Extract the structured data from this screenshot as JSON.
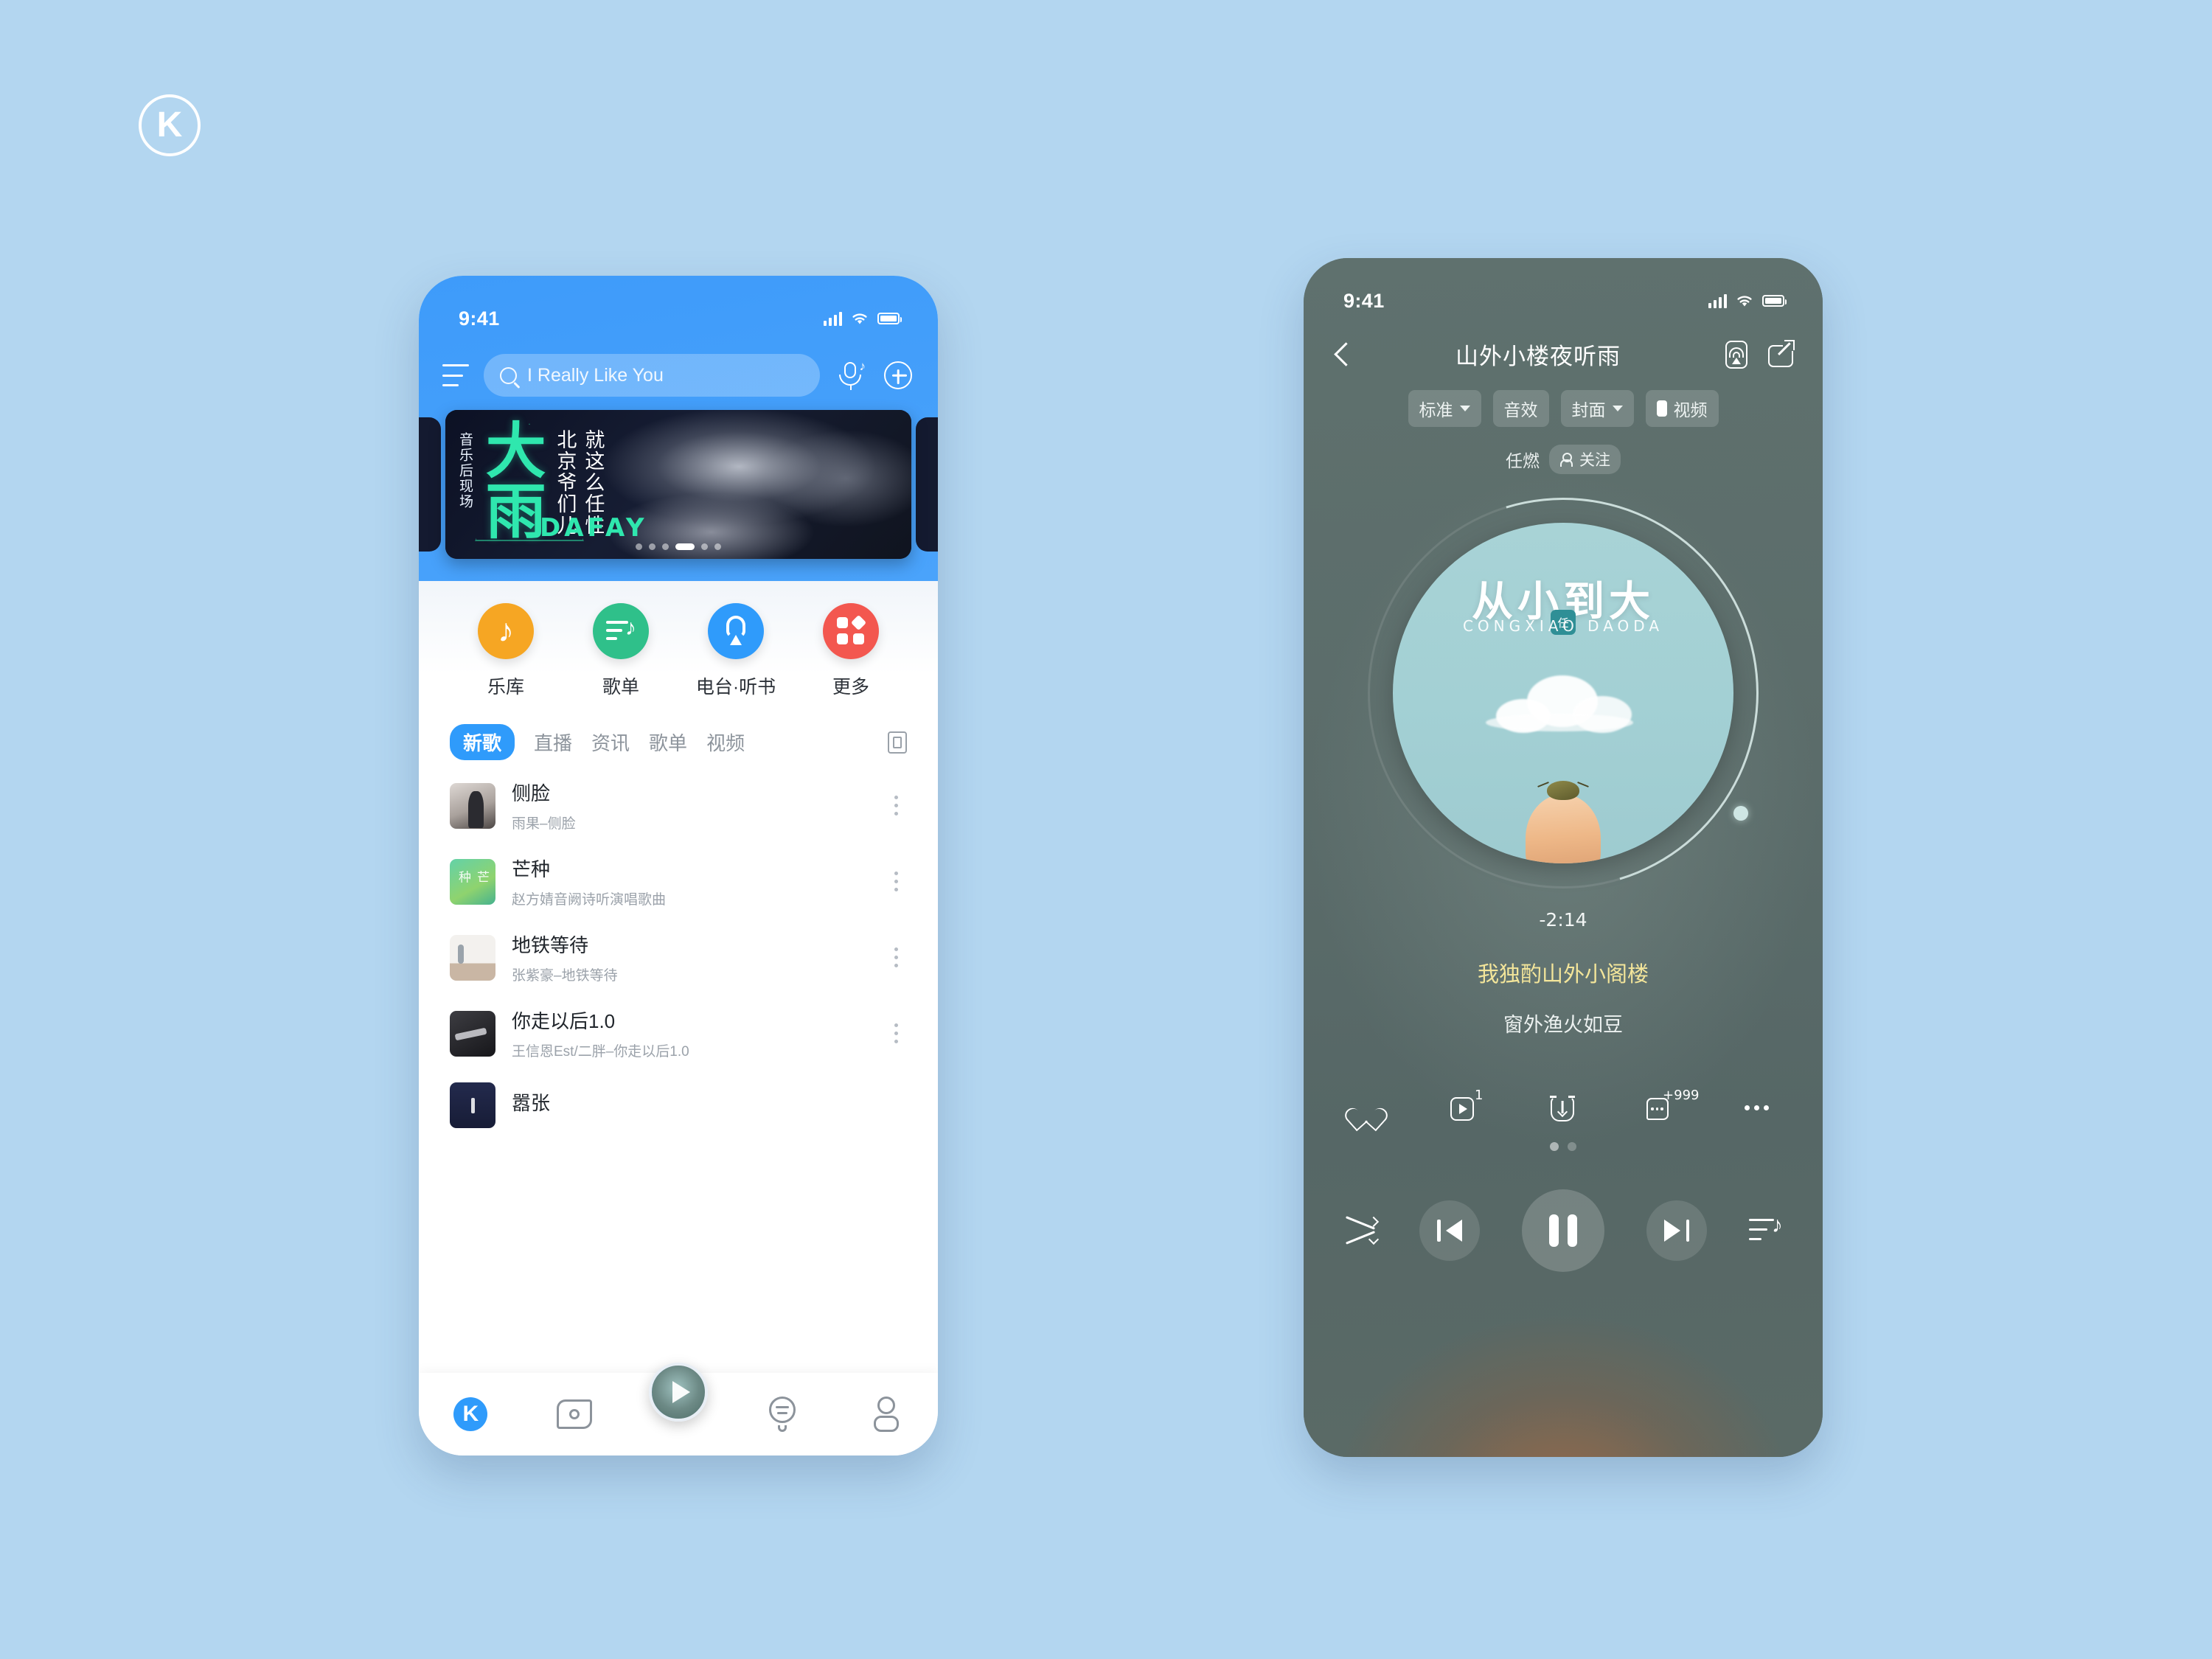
{
  "brand": {
    "logo_letter": "K"
  },
  "home": {
    "status": {
      "time": "9:41"
    },
    "search": {
      "placeholder": "I Really Like You",
      "value": ""
    },
    "header_icons": {
      "menu": "hamburger-menu-icon",
      "voice": "voice-search-icon",
      "add": "plus-circle-icon"
    },
    "banner": {
      "vertical_left": "音乐后现场",
      "big_word": "大雨",
      "col1": "北京爷们儿",
      "col2": "就这么任性",
      "latin": "DAFAY",
      "dots_total": 6,
      "dots_active": 3
    },
    "categories": [
      {
        "label": "乐库",
        "color": "#f6a623",
        "icon": "music-note-icon"
      },
      {
        "label": "歌单",
        "color": "#2fc08a",
        "icon": "playlist-icon"
      },
      {
        "label": "电台·听书",
        "color": "#2f9bfb",
        "icon": "radio-icon"
      },
      {
        "label": "更多",
        "color": "#f3574f",
        "icon": "grid-more-icon"
      }
    ],
    "tabs": [
      {
        "label": "新歌",
        "active": true
      },
      {
        "label": "直播",
        "active": false
      },
      {
        "label": "资讯",
        "active": false
      },
      {
        "label": "歌单",
        "active": false
      },
      {
        "label": "视频",
        "active": false
      }
    ],
    "tabs_right_icon": "multi-window-icon",
    "songs": [
      {
        "title": "侧脸",
        "subtitle": "雨果–侧脸"
      },
      {
        "title": "芒种",
        "subtitle": "赵方婧音阙诗听演唱歌曲"
      },
      {
        "title": "地铁等待",
        "subtitle": "张紫豪–地铁等待"
      },
      {
        "title": "你走以后1.0",
        "subtitle": "王信恩Est/二胖–你走以后1.0"
      },
      {
        "title": "嚣张",
        "subtitle": ""
      }
    ],
    "bottom_nav": [
      {
        "name": "home",
        "label": "K",
        "icon": "k-logo-icon",
        "active": true
      },
      {
        "name": "video",
        "label": "",
        "icon": "camera-icon",
        "active": false
      },
      {
        "name": "player",
        "label": "",
        "icon": "mini-player-play-icon",
        "active": false
      },
      {
        "name": "discover",
        "label": "",
        "icon": "discover-icon",
        "active": false
      },
      {
        "name": "profile",
        "label": "",
        "icon": "user-icon",
        "active": false
      }
    ]
  },
  "player": {
    "status": {
      "time": "9:41"
    },
    "title": "山外小楼夜听雨",
    "back_icon": "chevron-left-icon",
    "cast_icon": "cast-icon",
    "share_icon": "share-external-icon",
    "chips": [
      {
        "label": "标准",
        "caret": true
      },
      {
        "label": "音效",
        "caret": false
      },
      {
        "label": "封面",
        "caret": true
      },
      {
        "label": "视频",
        "caret": false,
        "glyph": "phone-icon"
      }
    ],
    "artist": {
      "name": "任燃",
      "follow_label": "关注",
      "follow_icon": "user-add-icon"
    },
    "album_art": {
      "title": "从小到大",
      "seal": "任",
      "pinyin": "CONGXIAO DAODA"
    },
    "time_remaining": "-2:14",
    "lyrics": {
      "current": "我独酌山外小阁楼",
      "next": "窗外渔火如豆"
    },
    "actions": [
      {
        "name": "like",
        "icon": "heart-icon",
        "badge": ""
      },
      {
        "name": "mv",
        "icon": "mv-play-icon",
        "badge": "1"
      },
      {
        "name": "download",
        "icon": "download-icon",
        "badge": ""
      },
      {
        "name": "comment",
        "icon": "comment-icon",
        "badge": "+999"
      },
      {
        "name": "more",
        "icon": "more-dots-icon",
        "badge": ""
      }
    ],
    "page_dots": {
      "total": 2,
      "active": 0
    },
    "transport": [
      {
        "name": "shuffle",
        "icon": "shuffle-icon"
      },
      {
        "name": "previous",
        "icon": "previous-track-icon"
      },
      {
        "name": "playpause",
        "icon": "pause-icon"
      },
      {
        "name": "next",
        "icon": "next-track-icon"
      },
      {
        "name": "queue",
        "icon": "playlist-queue-icon"
      }
    ]
  }
}
